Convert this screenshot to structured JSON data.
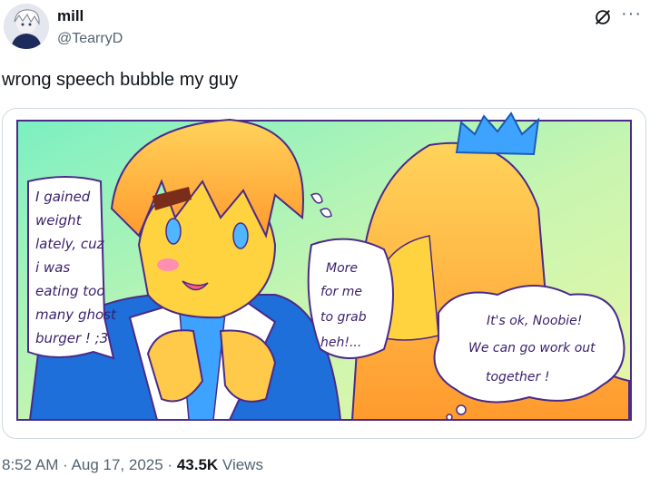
{
  "author": {
    "name": "mill",
    "handle": "@TearryD"
  },
  "icons": {
    "grok": "grok-icon",
    "more": "more-icon"
  },
  "tweet": {
    "text": "wrong speech bubble my guy"
  },
  "comic": {
    "bubble_left": [
      "I gained",
      "weight",
      "lately, cuz",
      "i was",
      "eating too",
      "many ghost",
      "burger ! ;3"
    ],
    "bubble_middle": [
      "More",
      "for me",
      "to grab",
      "heh!..."
    ],
    "bubble_right": [
      "It's ok, Noobie!",
      "We can go work out",
      "together !"
    ]
  },
  "meta": {
    "time": "8:52 AM",
    "sep1": " · ",
    "date": "Aug 17, 2025",
    "sep2": " · ",
    "views_count": "43.5K",
    "views_label": " Views"
  },
  "colors": {
    "accent": "#1d9bf0",
    "text_secondary": "#536471",
    "line": "#4b2a8a"
  }
}
